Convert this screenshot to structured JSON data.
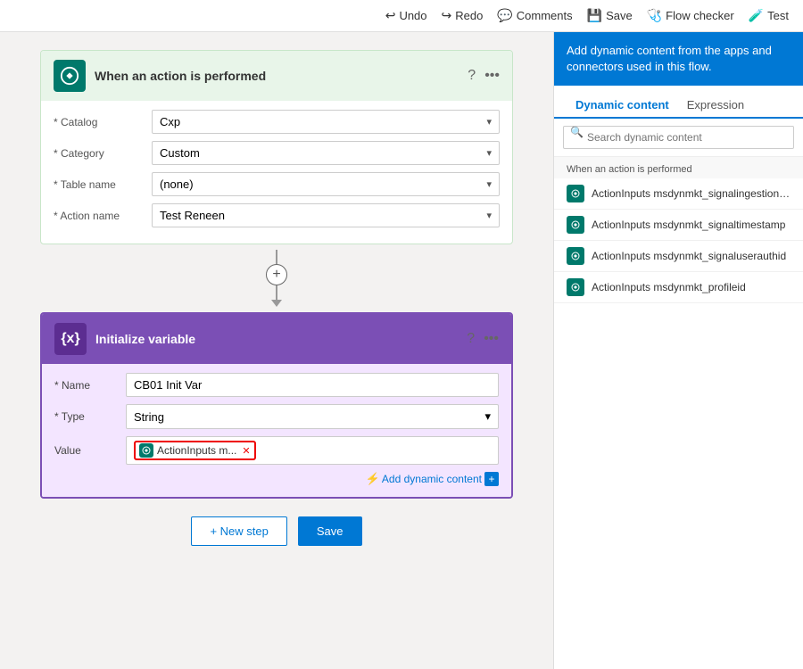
{
  "toolbar": {
    "undo_label": "Undo",
    "redo_label": "Redo",
    "comments_label": "Comments",
    "save_label": "Save",
    "flow_checker_label": "Flow checker",
    "test_label": "Test"
  },
  "trigger": {
    "title": "When an action is performed",
    "catalog_label": "* Catalog",
    "catalog_value": "Cxp",
    "category_label": "* Category",
    "category_value": "Custom",
    "table_name_label": "* Table name",
    "table_name_value": "(none)",
    "action_name_label": "* Action name",
    "action_name_value": "Test Reneen"
  },
  "init_variable": {
    "title": "Initialize variable",
    "name_label": "* Name",
    "name_value": "CB01 Init Var",
    "type_label": "* Type",
    "type_value": "String",
    "value_label": "Value",
    "token_text": "ActionInputs m...",
    "add_dynamic_label": "Add dynamic content"
  },
  "bottom_buttons": {
    "new_step_label": "+ New step",
    "save_label": "Save"
  },
  "dynamic_panel": {
    "header_text": "Add dynamic content from the apps and connectors used in this flow.",
    "tab_dynamic": "Dynamic content",
    "tab_expression": "Expression",
    "search_placeholder": "Search dynamic content",
    "section_label": "When an action is performed",
    "items": [
      {
        "text": "ActionInputs msdynmkt_signalingestiontimestamp"
      },
      {
        "text": "ActionInputs msdynmkt_signaltimestamp"
      },
      {
        "text": "ActionInputs msdynmkt_signaluserauthid"
      },
      {
        "text": "ActionInputs msdynmkt_profileid"
      }
    ]
  }
}
